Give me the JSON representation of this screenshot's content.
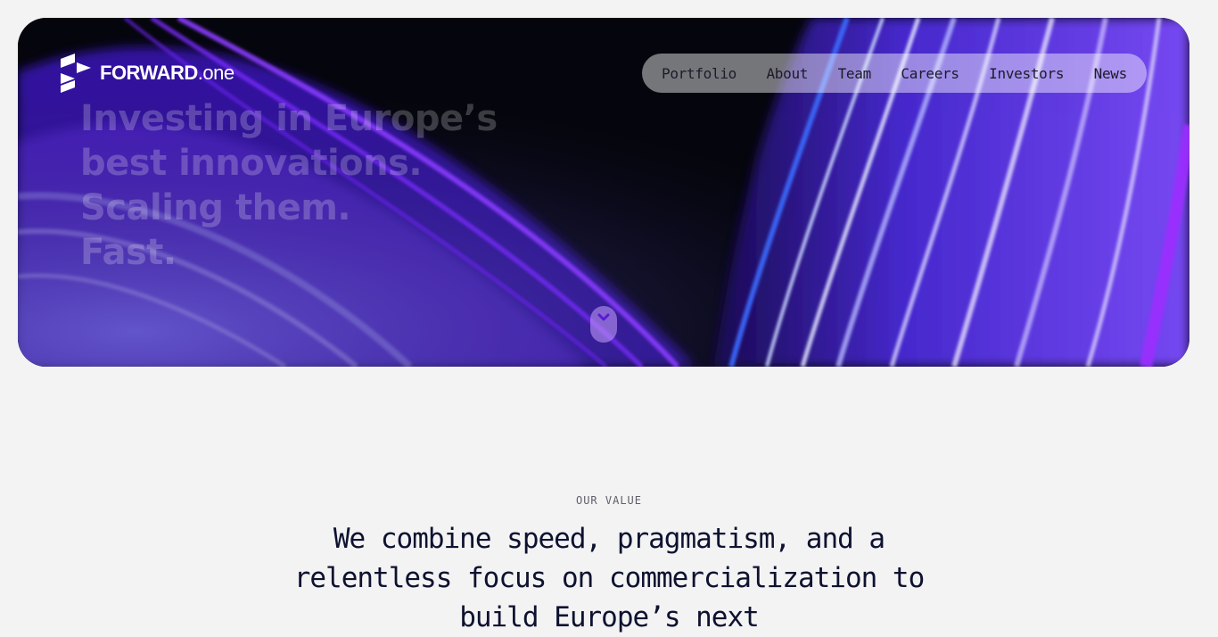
{
  "brand": {
    "name_bold": "FORWARD",
    "name_light": ".one",
    "icon": "forward-one-logo-icon"
  },
  "nav": {
    "items": [
      {
        "label": "Portfolio"
      },
      {
        "label": "About"
      },
      {
        "label": "Team"
      },
      {
        "label": "Careers"
      },
      {
        "label": "Investors"
      },
      {
        "label": "News"
      }
    ]
  },
  "hero": {
    "headline_lines": [
      "Investing in Europe’s",
      "best innovations.",
      "Scaling them.",
      "Fast."
    ],
    "scroll_icon": "chevron-down-icon"
  },
  "value": {
    "eyebrow": "OUR VALUE",
    "text": "We combine speed, pragmatism, and a relentless focus on commercialization to build Europe’s next"
  },
  "colors": {
    "page_bg": "#f3f3f3",
    "hero_bg": "#05060d",
    "accent_purple": "#7b1fff",
    "text_dark": "#0e1230"
  }
}
